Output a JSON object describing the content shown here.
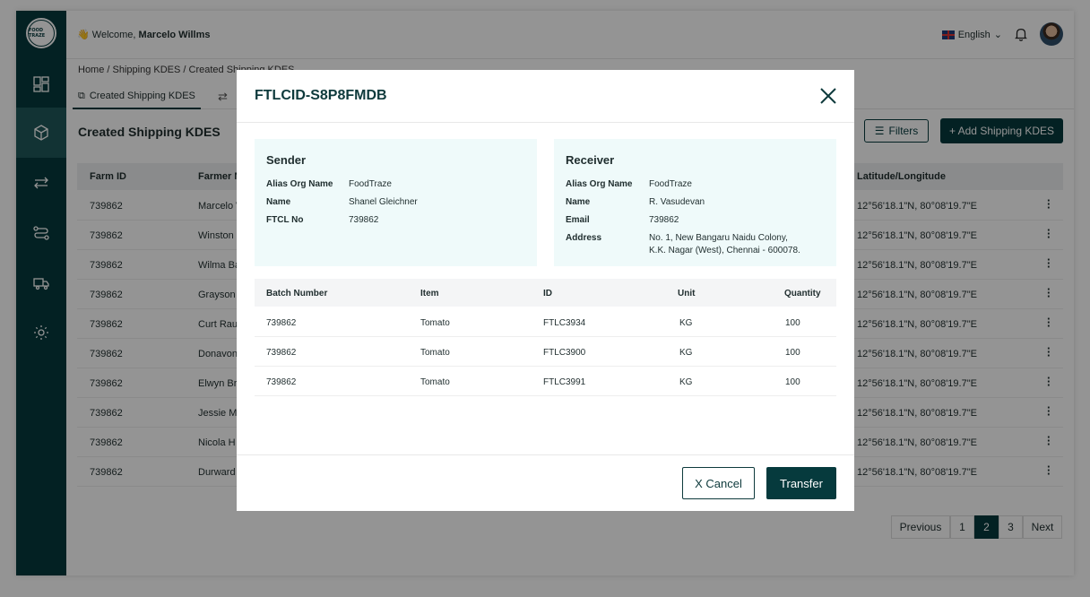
{
  "app": {
    "logo_text": "FOOD TRAZE"
  },
  "topbar": {
    "welcome_prefix": "Welcome,",
    "user_name": "Marcelo Willms",
    "language": "English"
  },
  "breadcrumb": "Home / Shipping KDES / Created Shipping KDES",
  "tabs": [
    {
      "label": "Created Shipping KDES"
    }
  ],
  "page": {
    "title": "Created Shipping KDES",
    "filters_label": "Filters",
    "add_label": "+ Add Shipping KDES"
  },
  "table": {
    "headers": {
      "farm_id": "Farm ID",
      "farmer": "Farmer Name",
      "latlong": "Latitude/Longitude"
    },
    "rows": [
      {
        "farm_id": "739862",
        "farmer": "Marcelo Willms",
        "latlong": "12°56'18.1\"N, 80°08'19.7\"E"
      },
      {
        "farm_id": "739862",
        "farmer": "Winston",
        "latlong": "12°56'18.1\"N, 80°08'19.7\"E"
      },
      {
        "farm_id": "739862",
        "farmer": "Wilma Ba",
        "latlong": "12°56'18.1\"N, 80°08'19.7\"E"
      },
      {
        "farm_id": "739862",
        "farmer": "Grayson",
        "latlong": "12°56'18.1\"N, 80°08'19.7\"E"
      },
      {
        "farm_id": "739862",
        "farmer": "Curt Rau",
        "latlong": "12°56'18.1\"N, 80°08'19.7\"E"
      },
      {
        "farm_id": "739862",
        "farmer": "Donavon",
        "latlong": "12°56'18.1\"N, 80°08'19.7\"E"
      },
      {
        "farm_id": "739862",
        "farmer": "Elwyn Br",
        "latlong": "12°56'18.1\"N, 80°08'19.7\"E"
      },
      {
        "farm_id": "739862",
        "farmer": "Jessie M",
        "latlong": "12°56'18.1\"N, 80°08'19.7\"E"
      },
      {
        "farm_id": "739862",
        "farmer": "Nicola H",
        "latlong": "12°56'18.1\"N, 80°08'19.7\"E"
      },
      {
        "farm_id": "739862",
        "farmer": "Durward",
        "latlong": "12°56'18.1\"N, 80°08'19.7\"E"
      }
    ]
  },
  "pagination": {
    "prev": "Previous",
    "pages": [
      "1",
      "2",
      "3"
    ],
    "current": "2",
    "next": "Next"
  },
  "modal": {
    "title": "FTLCID-S8P8FMDB",
    "sender": {
      "heading": "Sender",
      "fields": [
        {
          "k": "Alias Org Name",
          "v": "FoodTraze"
        },
        {
          "k": "Name",
          "v": "Shanel Gleichner"
        },
        {
          "k": "FTCL No",
          "v": "739862"
        }
      ]
    },
    "receiver": {
      "heading": "Receiver",
      "fields": [
        {
          "k": "Alias Org Name",
          "v": "FoodTraze"
        },
        {
          "k": "Name",
          "v": "R. Vasudevan"
        },
        {
          "k": "Email",
          "v": "739862"
        },
        {
          "k": "Address",
          "v": "No. 1, New Bangaru Naidu Colony,"
        },
        {
          "k": "",
          "v": "K.K. Nagar (West), Chennai - 600078."
        }
      ]
    },
    "items_headers": {
      "batch": "Batch Number",
      "item": "Item",
      "id": "ID",
      "unit": "Unit",
      "qty": "Quantity"
    },
    "items": [
      {
        "batch": "739862",
        "item": "Tomato",
        "id": "FTLC3934",
        "unit": "KG",
        "qty": "100"
      },
      {
        "batch": "739862",
        "item": "Tomato",
        "id": "FTLC3900",
        "unit": "KG",
        "qty": "100"
      },
      {
        "batch": "739862",
        "item": "Tomato",
        "id": "FTLC3991",
        "unit": "KG",
        "qty": "100"
      }
    ],
    "cancel_label": "X Cancel",
    "transfer_label": "Transfer"
  },
  "colors": {
    "primary": "#063a3d",
    "card_bg": "#effafa"
  }
}
